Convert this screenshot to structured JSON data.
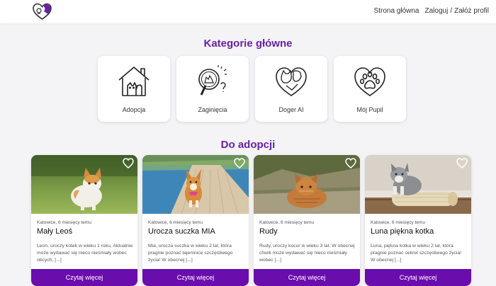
{
  "nav": {
    "home": "Strona główna",
    "login": "Zaloguj",
    "separator": "/",
    "register": "Załóż profil"
  },
  "sections": {
    "categories_title": "Kategorie główne",
    "adoption_title": "Do adopcji"
  },
  "categories": [
    {
      "label": "Adopcja",
      "icon": "house-with-pets-icon"
    },
    {
      "label": "Zaginięcia",
      "icon": "magnifier-search-icon"
    },
    {
      "label": "Doger AI",
      "icon": "pets-heart-icon"
    },
    {
      "label": "Mój Pupil",
      "icon": "paw-heart-icon"
    }
  ],
  "adoption_cards": [
    {
      "meta": "Katowice, 6 miesięcy temu",
      "title": "Mały Leoś",
      "description": "Leon, uroczy kotek w wieku 1 roku, Aktualnie może wydawać się nieco nieśmiały wobec obcych, [...]",
      "button": "Czytaj więcej"
    },
    {
      "meta": "Katowice, 6 miesięcy temu",
      "title": "Urocza suczka MIA",
      "description": "Mia, urocza suczka w wieku 2 lat, która pragnie poznać tajemnice szczęśliwego życia! W obecnej [...]",
      "button": "Czytaj więcej"
    },
    {
      "meta": "Katowice, 6 miesięcy temu",
      "title": "Rudy",
      "description": "Rudy, uroczy kocur w wieku 3 lat. W obecnej chwili może wydawać się nieco nieśmiały wobec [...]",
      "button": "Czytaj więcej"
    },
    {
      "meta": "Katowice, 6 miesięcy temu",
      "title": "Luna piękna kotka",
      "description": "Luna, piękna kotka w wieku 2 lat, która pragnie poznać sekret szczęśliwego życia! W obecnej [...]",
      "button": "Czytaj więcej"
    }
  ],
  "colors": {
    "accent": "#6a1fa8",
    "button": "#6a0dad"
  }
}
